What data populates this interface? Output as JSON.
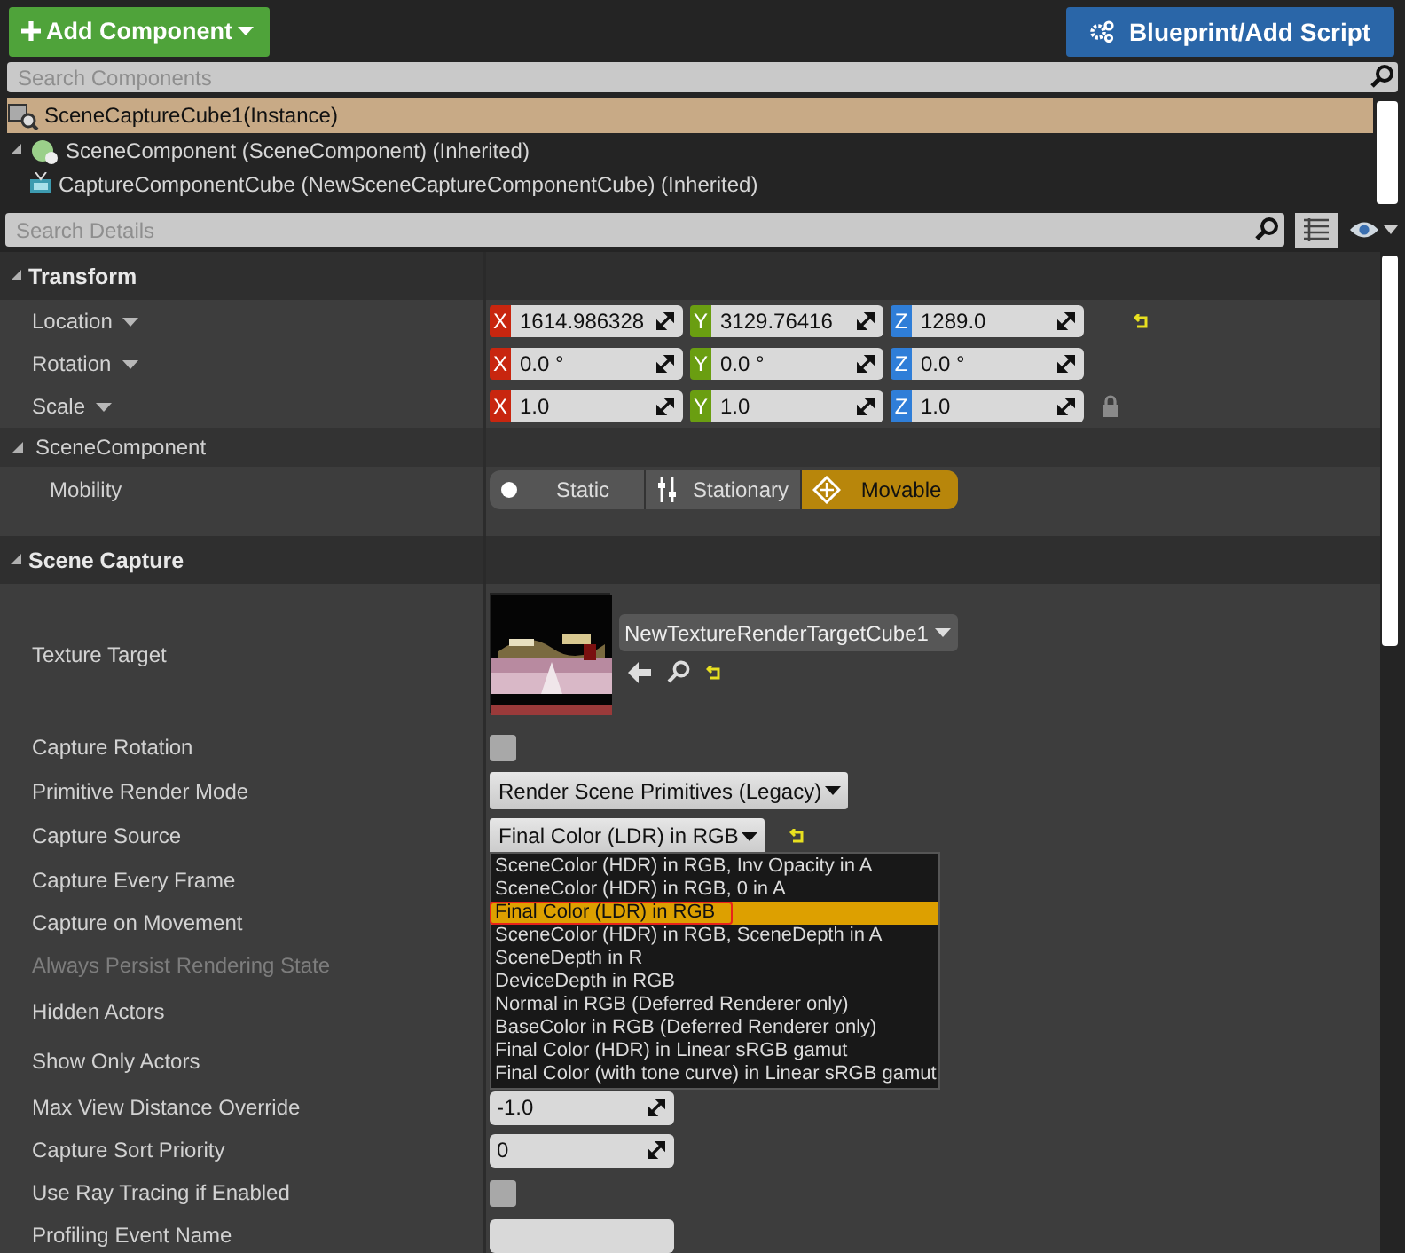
{
  "toolbar": {
    "add_button": "Add Component",
    "blueprint_button": "Blueprint/Add Script"
  },
  "component_search": {
    "placeholder": "Search Components"
  },
  "components": [
    {
      "label": "SceneCaptureCube1(Instance)",
      "selected": true,
      "children": [
        {
          "label": "SceneComponent (SceneComponent) (Inherited)",
          "selected": false,
          "expanded": true,
          "children": [
            {
              "label": "CaptureComponentCube (NewSceneCaptureComponentCube) (Inherited)",
              "selected": false
            }
          ]
        }
      ]
    }
  ],
  "details_search": {
    "placeholder": "Search Details"
  },
  "sections": [
    {
      "title": "Transform",
      "expanded": true,
      "rows": [
        {
          "kind": "vector",
          "label": "Location",
          "values": [
            {
              "axis": "X",
              "value": "1614.986328"
            },
            {
              "axis": "Y",
              "value": "3129.76416"
            },
            {
              "axis": "Z",
              "value": "1289.0"
            }
          ],
          "reset": true
        },
        {
          "kind": "vector",
          "label": "Rotation",
          "values": [
            {
              "axis": "X",
              "value": "0.0 °"
            },
            {
              "axis": "Y",
              "value": "0.0 °"
            },
            {
              "axis": "Z",
              "value": "0.0 °"
            }
          ]
        },
        {
          "kind": "vector",
          "label": "Scale",
          "values": [
            {
              "axis": "X",
              "value": "1.0"
            },
            {
              "axis": "Y",
              "value": "1.0"
            },
            {
              "axis": "Z",
              "value": "1.0"
            }
          ],
          "locked": true
        },
        {
          "kind": "subheader",
          "label": "SceneComponent",
          "expanded": true
        },
        {
          "kind": "mobility",
          "label": "Mobility",
          "options": [
            {
              "label": "Static",
              "selected": false
            },
            {
              "label": "Stationary",
              "selected": false
            },
            {
              "label": "Movable",
              "selected": true
            }
          ]
        }
      ]
    },
    {
      "title": "Scene Capture",
      "expanded": true,
      "rows": [
        {
          "kind": "texture",
          "label": "Texture Target",
          "asset": "NewTextureRenderTargetCube1",
          "reset": true
        },
        {
          "kind": "checkbox",
          "label": "Capture Rotation",
          "checked": false
        },
        {
          "kind": "combo",
          "label": "Primitive Render Mode",
          "value": "Render Scene Primitives (Legacy)",
          "open": false
        },
        {
          "kind": "combo",
          "label": "Capture Source",
          "value": "Final Color (LDR) in RGB",
          "reset": true,
          "open": true,
          "options": [
            {
              "label": "SceneColor (HDR) in RGB, Inv Opacity in A",
              "selected": false,
              "annotated": false
            },
            {
              "label": "SceneColor (HDR) in RGB, 0 in A",
              "selected": false,
              "annotated": false
            },
            {
              "label": "Final Color (LDR) in RGB",
              "selected": true,
              "annotated": true
            },
            {
              "label": "SceneColor (HDR) in RGB, SceneDepth in A",
              "selected": false,
              "annotated": false
            },
            {
              "label": "SceneDepth in R",
              "selected": false,
              "annotated": false
            },
            {
              "label": "DeviceDepth in RGB",
              "selected": false,
              "annotated": false
            },
            {
              "label": "Normal in RGB (Deferred Renderer only)",
              "selected": false,
              "annotated": false
            },
            {
              "label": "BaseColor in RGB (Deferred Renderer only)",
              "selected": false,
              "annotated": false
            },
            {
              "label": "Final Color (HDR) in Linear sRGB gamut",
              "selected": false,
              "annotated": false
            },
            {
              "label": "Final Color (with tone curve) in Linear sRGB gamut",
              "selected": false,
              "annotated": false
            }
          ]
        },
        {
          "kind": "label",
          "label": "Capture Every Frame",
          "disabled": false
        },
        {
          "kind": "label",
          "label": "Capture on Movement",
          "disabled": false
        },
        {
          "kind": "label",
          "label": "Always Persist Rendering State",
          "disabled": true
        },
        {
          "kind": "actors",
          "label": "Hidden Actors",
          "disabled": false
        },
        {
          "kind": "actors",
          "label": "Show Only Actors",
          "disabled": false
        },
        {
          "kind": "number",
          "label": "Max View Distance Override",
          "value": "-1.0"
        },
        {
          "kind": "number",
          "label": "Capture Sort Priority",
          "value": "0"
        },
        {
          "kind": "checkbox",
          "label": "Use Ray Tracing if Enabled",
          "checked": false
        },
        {
          "kind": "text",
          "label": "Profiling Event Name"
        }
      ]
    }
  ]
}
